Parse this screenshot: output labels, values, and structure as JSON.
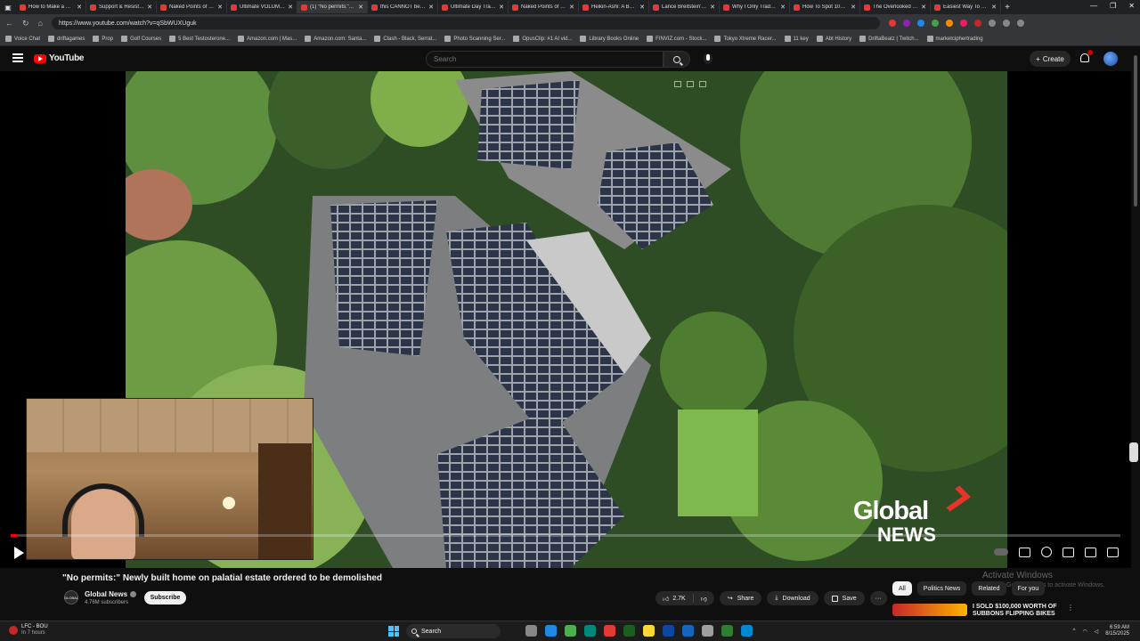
{
  "browser": {
    "tabs": [
      {
        "label": "How to Make a TR...",
        "active": false
      },
      {
        "label": "Support & Resista...",
        "active": false
      },
      {
        "label": "Naked Points of C...",
        "active": false
      },
      {
        "label": "Ultimate VOLUME...",
        "active": false
      },
      {
        "label": "(1) \"No permits:\"...",
        "active": true
      },
      {
        "label": "this CANNOT be re...",
        "active": false
      },
      {
        "label": "Ultimate Day Tradi...",
        "active": false
      },
      {
        "label": "Naked Points of C...",
        "active": false
      },
      {
        "label": "Heikin-Ashi: A Bett...",
        "active": false
      },
      {
        "label": "Lance Breitstein's...",
        "active": false
      },
      {
        "label": "Why I Only Trade...",
        "active": false
      },
      {
        "label": "How To Spot 100x...",
        "active": false
      },
      {
        "label": "The Overlooked St...",
        "active": false
      },
      {
        "label": "Easiest Way To Sta...",
        "active": false
      }
    ],
    "url": "https://www.youtube.com/watch?v=qSbWUXUguk",
    "bookmarks": [
      "Voice Chat",
      "driftagames",
      "Prop",
      "Golf Courses",
      "5 Best Testosterone...",
      "Amazon.com | Mas...",
      "Amazon.com: Santa...",
      "Clash - Black, Serrat...",
      "Photo Scanning Ser...",
      "OpusClip: #1 AI vid...",
      "Library Books Online",
      "FINVIZ.com - Stock...",
      "Tokyo Xtreme Racer...",
      "11 key",
      "Abt History",
      "DriftaBeatz | Twitch...",
      "marketciphertrading"
    ]
  },
  "youtube": {
    "logo_text": "YouTube",
    "search_placeholder": "Search",
    "create_label": "Create"
  },
  "video": {
    "progress_fraction": 0.006,
    "watermark_top": "Global",
    "watermark_bottom": "NEWS"
  },
  "meta": {
    "title": "\"No permits:\" Newly built home on palatial estate ordered to be demolished",
    "channel": "Global News",
    "channel_avatar_text": "GLOBAL",
    "subscribers": "4.76M subscribers",
    "subscribe_label": "Subscribe",
    "likes": "2.7K",
    "share_label": "Share",
    "download_label": "Download",
    "save_label": "Save",
    "more_label": "···",
    "chips": [
      "All",
      "Politics News",
      "Related",
      "For you"
    ],
    "activate_title": "Activate Windows",
    "activate_sub": "Go to Settings to activate Windows.",
    "rec_title": "I SOLD $100,000 WORTH OF SUBBONS FLIPPING BIKES"
  },
  "taskbar": {
    "weather_temp": "LFC - BOU",
    "weather_sub": "In 7 hours",
    "search_label": "Search",
    "time": "6:59 AM",
    "date": "8/15/2025"
  }
}
